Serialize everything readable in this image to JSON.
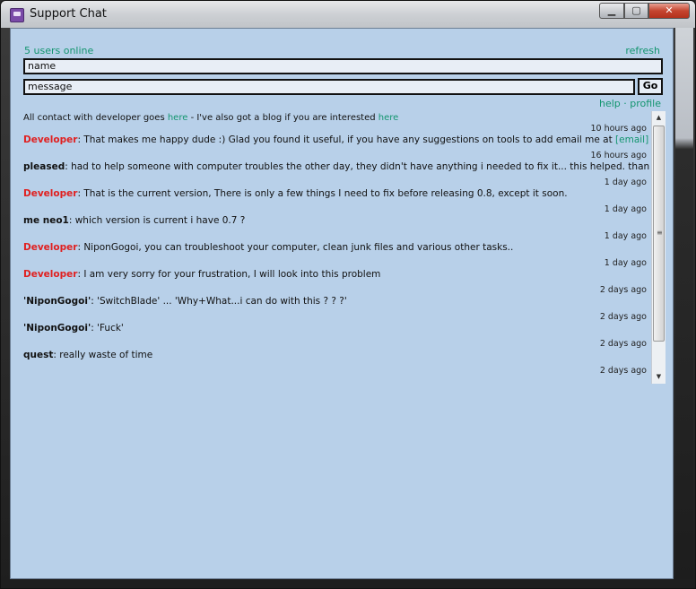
{
  "window": {
    "title": "Support Chat",
    "controls": {
      "minimize": "▁",
      "maximize": "▢",
      "close": "✕"
    }
  },
  "header": {
    "online_count": "5 users online",
    "refresh_label": "refresh"
  },
  "form": {
    "name_value": "name",
    "message_value": "message",
    "go_label": "Go"
  },
  "links": {
    "help": "help",
    "separator": "·",
    "profile": "profile"
  },
  "intro": {
    "text1": "All contact with developer goes ",
    "link1": "here",
    "text2": " - I've also got a blog if you are interested ",
    "link2": "here"
  },
  "messages": [
    {
      "author": "Developer",
      "text": ": That makes me happy dude :) Glad you found it useful, if you have any suggestions on tools to add email me at ",
      "link": "[email]",
      "time": "10 hours ago"
    },
    {
      "author": "pleased",
      "text": ": had to help someone with computer troubles the other day, they didn't have anything i needed to fix it... this helped. thanks",
      "time": "16 hours ago"
    },
    {
      "author": "Developer",
      "text": ": That is the current version, There is only a few things I need to fix before releasing 0.8, except it soon.",
      "time": "1 day ago"
    },
    {
      "author": "me neo1",
      "text": ": which version is current i have 0.7 ?",
      "time": "1 day ago"
    },
    {
      "author": "Developer",
      "text": ": NiponGogoi, you can troubleshoot your computer, clean junk files and various other tasks..",
      "time": "1 day ago"
    },
    {
      "author": "Developer",
      "text": ": I am very sorry for your frustration, I will look into this problem",
      "time": "1 day ago"
    },
    {
      "author": "'NiponGogoi'",
      "text": ": 'SwitchBlade' ... 'Why+What...i can do with this ? ? ?'",
      "time": "2 days ago"
    },
    {
      "author": "'NiponGogoi'",
      "text": ": 'Fuck'",
      "time": "2 days ago"
    },
    {
      "author": "quest",
      "text": ": really waste of time",
      "time": "2 days ago"
    }
  ],
  "last_time": "2 days ago",
  "colors": {
    "background": "#b8d0e9",
    "link": "#13956f",
    "developer": "#e02020"
  },
  "icons": {
    "app": "chat-app-icon",
    "scroll_up": "▲",
    "scroll_down": "▼",
    "grip": "≡"
  }
}
